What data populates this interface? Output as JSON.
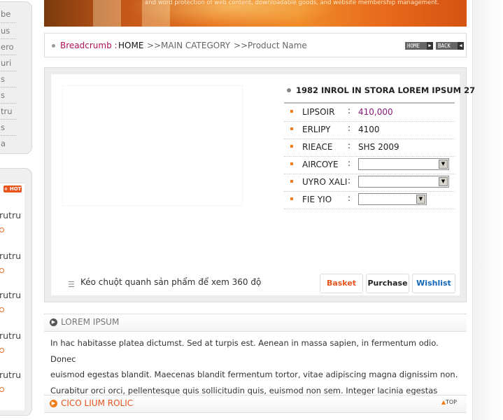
{
  "sidebar": {
    "menu_items": [
      "be",
      "us",
      "ero",
      "uri",
      "s",
      "s",
      "tru",
      "s",
      "a"
    ],
    "hot_badge": "+ HOT",
    "hot_items": [
      "rutru",
      "rutru",
      "rutru",
      "rutru",
      "rutru"
    ]
  },
  "banner": {
    "tagline": "and word protection of web content, downloadable goods, and website membership management."
  },
  "breadcrumb": {
    "label": "Breadcrumb :",
    "home": "HOME",
    "sep1": ">>",
    "category": "MAIN CATEGORY",
    "sep2": ">>",
    "product": "Product Name",
    "home_button": "HOME",
    "back_button": "BACK"
  },
  "product": {
    "title": "1982 INROL IN STORA LOREM IPSUM 27",
    "attributes": [
      {
        "label": "LIPSOIR",
        "colon": ":",
        "value": "410,000"
      },
      {
        "label": "ERLIPY",
        "colon": ":",
        "value": "4100"
      },
      {
        "label": "RIEACE",
        "colon": ":",
        "value": "SHS 2009"
      },
      {
        "label": "AIRCOYE",
        "colon": ":",
        "value": ""
      },
      {
        "label": "UYRO XALI",
        "colon": ":",
        "value": ""
      },
      {
        "label": "FIE YIO",
        "colon": ":",
        "value": ""
      }
    ],
    "rotate_hint": "Kéo chuột quanh sản phẩm để xem 360 độ",
    "basket": "Basket",
    "purchase": "Purchase",
    "wishlist": "Wishlist"
  },
  "lorem": {
    "title": "LOREM IPSUM",
    "lines": [
      "In hac habitasse platea dictumst. Sed at turpis est. Aenean in massa sapien, in fermentum odio. Donec",
      "euismod egestas blandit. Maecenas blandit fermentum tortor, vitae adipiscing magna dignissim non.",
      "Curabitur orci orci, pellentesque quis sollicitudin quis, euismod non sem. Integer lacinia egestas faucibus."
    ]
  },
  "section2": {
    "title": "CICO LIUM ROLIC",
    "top": "TOP"
  },
  "colors": {
    "accent_orange": "#f07d1a",
    "breadcrumb_label": "#b01055",
    "price": "#8a1a7a",
    "wishlist": "#1266b8"
  }
}
